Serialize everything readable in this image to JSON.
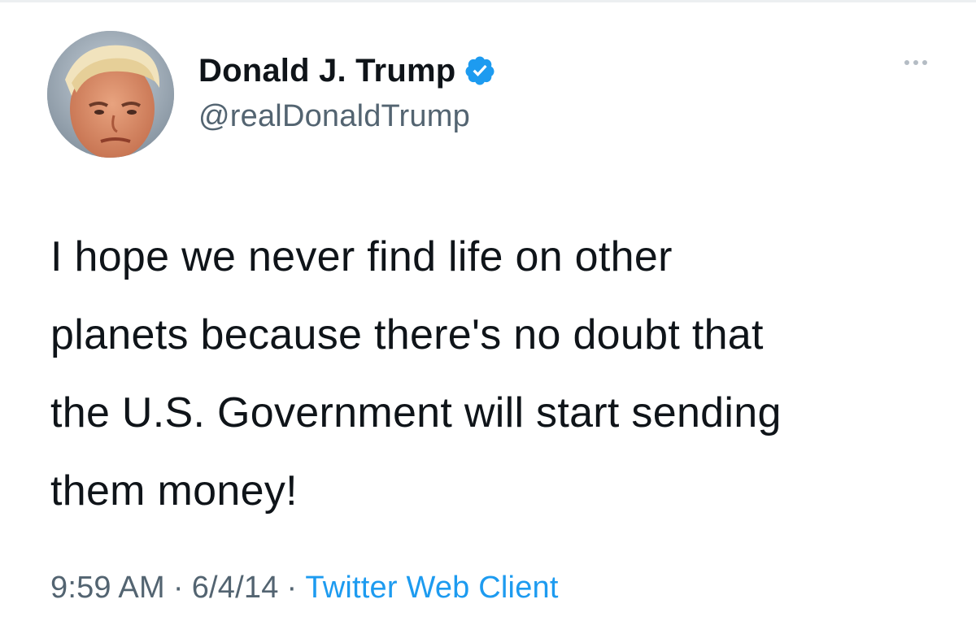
{
  "tweet": {
    "display_name": "Donald J. Trump",
    "handle": "@realDonaldTrump",
    "text_lines": [
      "I hope we never find life on other",
      "planets because there's no doubt that",
      "the U.S. Government will start sending",
      "them money!"
    ],
    "time": "9:59 AM",
    "date": "6/4/14",
    "separator": "·",
    "source": "Twitter Web Client",
    "icons": {
      "verified": "verified-badge-icon",
      "more": "more-options-icon"
    }
  },
  "colors": {
    "text": "#0f1419",
    "secondary": "#536471",
    "link": "#1d9bf0",
    "verified": "#1d9bf0"
  }
}
